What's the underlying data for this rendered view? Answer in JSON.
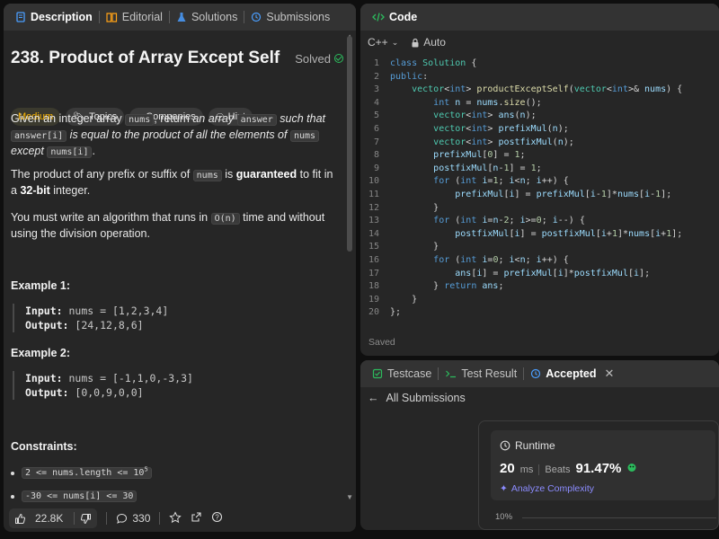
{
  "left_tabs": {
    "description": "Description",
    "editorial": "Editorial",
    "solutions": "Solutions",
    "submissions": "Submissions"
  },
  "problem": {
    "title": "238. Product of Array Except Self",
    "status": "Solved",
    "difficulty": "Medium",
    "chips": [
      "Topics",
      "Companies",
      "Hint"
    ]
  },
  "description": {
    "p1_a": "Given an integer array ",
    "p1_code1": "nums",
    "p1_b": ", return ",
    "p1_c": "an array",
    "p1_code2": "answer",
    "p1_d": " such that",
    "p1_code3": "answer[i]",
    "p1_e": " is equal to the product of all the elements of ",
    "p1_code4": "nums",
    "p1_f": " except",
    "p1_code5": "nums[i]",
    "p1_g": ".",
    "p2_a": "The product of any prefix or suffix of ",
    "p2_code": "nums",
    "p2_b": " is ",
    "p2_bold": "guaranteed",
    "p2_c": " to fit in a ",
    "p2_bold2": "32-bit",
    "p2_d": " integer.",
    "p3_a": "You must write an algorithm that runs in ",
    "p3_code": "O(n)",
    "p3_b": " time and without using the division operation."
  },
  "examples": [
    {
      "heading": "Example 1:",
      "input_label": "Input:",
      "input": "nums = [1,2,3,4]",
      "output_label": "Output:",
      "output": "[24,12,8,6]"
    },
    {
      "heading": "Example 2:",
      "input_label": "Input:",
      "input": "nums = [-1,1,0,-3,3]",
      "output_label": "Output:",
      "output": "[0,0,9,0,0]"
    }
  ],
  "constraints": {
    "heading": "Constraints:",
    "c1": "2 <= nums.length <= 10",
    "c1_sup": "5",
    "c2": "-30 <= nums[i] <= 30"
  },
  "footer": {
    "likes": "22.8K",
    "comments": "330"
  },
  "code_panel": {
    "title": "Code",
    "language": "C++",
    "mode": "Auto",
    "saved": "Saved",
    "lines": [
      "class Solution {",
      "public:",
      "    vector<int> productExceptSelf(vector<int>& nums) {",
      "        int n = nums.size();",
      "        vector<int> ans(n);",
      "        vector<int> prefixMul(n);",
      "        vector<int> postfixMul(n);",
      "        prefixMul[0] = 1;",
      "        postfixMul[n-1] = 1;",
      "        for (int i=1; i<n; i++) {",
      "            prefixMul[i] = prefixMul[i-1]*nums[i-1];",
      "        }",
      "        for (int i=n-2; i>=0; i--) {",
      "            postfixMul[i] = postfixMul[i+1]*nums[i+1];",
      "        }",
      "        for (int i=0; i<n; i++) {",
      "            ans[i] = prefixMul[i]*postfixMul[i];",
      "        } return ans;",
      "    }",
      "};"
    ]
  },
  "result_panel": {
    "tabs": {
      "testcase": "Testcase",
      "test_result": "Test Result",
      "accepted": "Accepted"
    },
    "back_label": "All Submissions",
    "runtime_label": "Runtime",
    "runtime_value": "20",
    "runtime_unit": "ms",
    "beats_label": "Beats",
    "beats_value": "91.47%",
    "analyze": "Analyze Complexity",
    "percent_tick": "10%"
  },
  "colors": {
    "accent_orange": "#ffa116",
    "accepted_green": "#2cbb5d",
    "medium": "#ffb800",
    "keyword_blue": "#569cd6",
    "type_teal": "#4ec9b0",
    "func_yellow": "#dcdcaa",
    "var_lightblue": "#9cdcfe",
    "number_green": "#b5cea8"
  }
}
